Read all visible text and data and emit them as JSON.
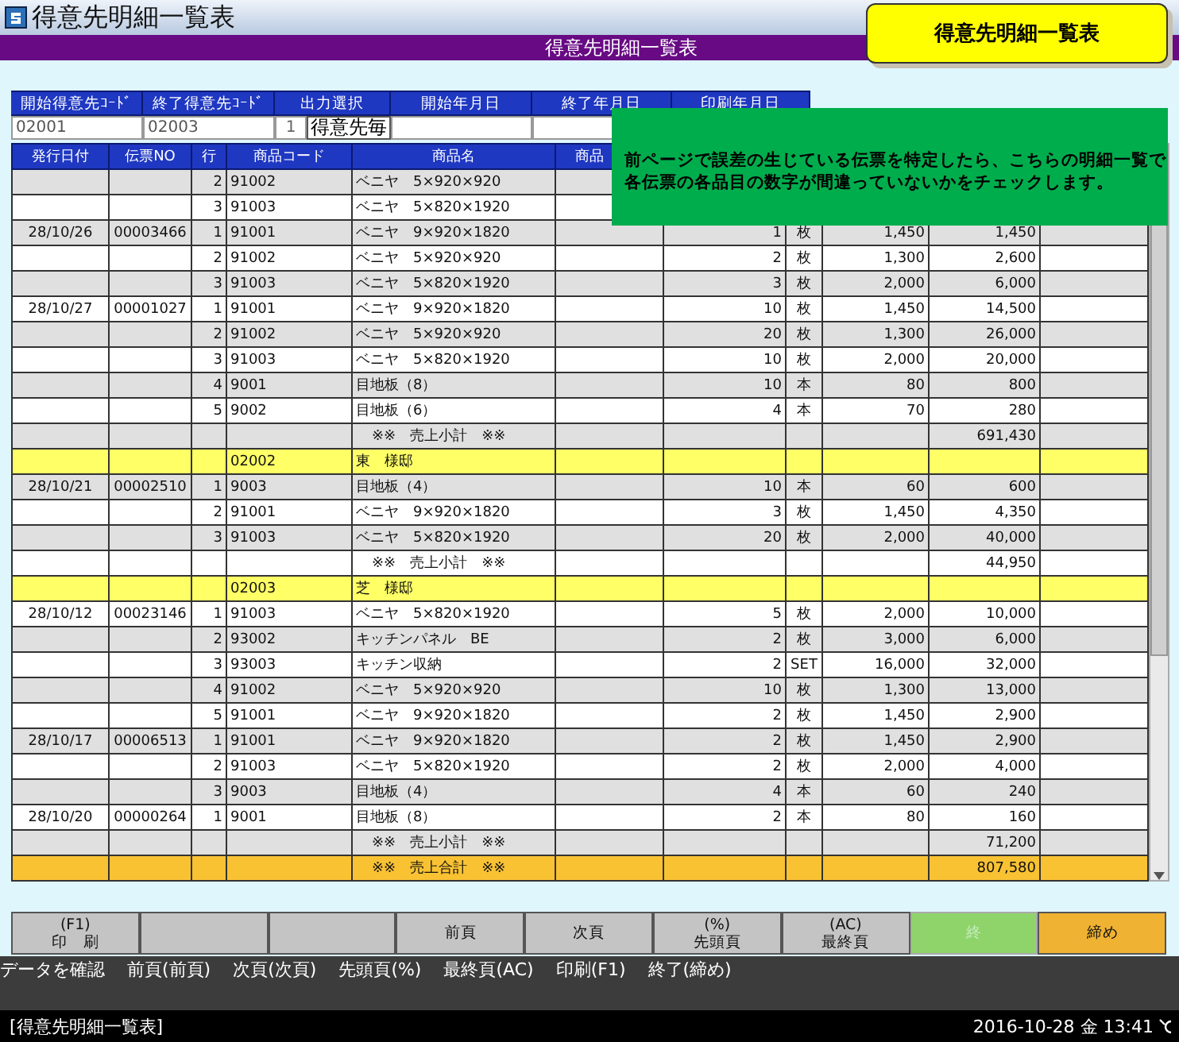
{
  "window": {
    "title": "得意先明細一覧表"
  },
  "header": {
    "title": "得意先明細一覧表"
  },
  "badge": {
    "text": "得意先明細一覧表"
  },
  "note": {
    "lines": [
      "前ページで誤差の生じている伝票を特定したら、こちらの明細一覧で",
      "各伝票の各品目の数字が間違っていないかをチェックします。"
    ]
  },
  "filters": {
    "labels": [
      "開始得意先ｺｰﾄﾞ",
      "終了得意先ｺｰﾄﾞ",
      "出力選択",
      "開始年月日",
      "終了年月日",
      "印刷年月日"
    ],
    "start_code": "02001",
    "end_code": "02003",
    "output_number": "1",
    "output_label": "得意先毎"
  },
  "table": {
    "columns": [
      "発行日付",
      "伝票NO",
      "行",
      "商品コード",
      "商品名",
      "商品"
    ],
    "rows": [
      {
        "kind": "item",
        "line": "2",
        "code": "91002",
        "name": "ベニヤ　5×920×920"
      },
      {
        "kind": "item",
        "line": "3",
        "code": "91003",
        "name": "ベニヤ　5×820×1920"
      },
      {
        "kind": "item",
        "date": "28/10/26",
        "slip_no": "00003466",
        "line": "1",
        "code": "91001",
        "name": "ベニヤ　9×920×1820",
        "qty": "1",
        "unit": "枚",
        "price": "1,450",
        "amount": "1,450"
      },
      {
        "kind": "item",
        "line": "2",
        "code": "91002",
        "name": "ベニヤ　5×920×920",
        "qty": "2",
        "unit": "枚",
        "price": "1,300",
        "amount": "2,600"
      },
      {
        "kind": "item",
        "line": "3",
        "code": "91003",
        "name": "ベニヤ　5×820×1920",
        "qty": "3",
        "unit": "枚",
        "price": "2,000",
        "amount": "6,000"
      },
      {
        "kind": "item",
        "date": "28/10/27",
        "slip_no": "00001027",
        "line": "1",
        "code": "91001",
        "name": "ベニヤ　9×920×1820",
        "qty": "10",
        "unit": "枚",
        "price": "1,450",
        "amount": "14,500"
      },
      {
        "kind": "item",
        "line": "2",
        "code": "91002",
        "name": "ベニヤ　5×920×920",
        "qty": "20",
        "unit": "枚",
        "price": "1,300",
        "amount": "26,000"
      },
      {
        "kind": "item",
        "line": "3",
        "code": "91003",
        "name": "ベニヤ　5×820×1920",
        "qty": "10",
        "unit": "枚",
        "price": "2,000",
        "amount": "20,000"
      },
      {
        "kind": "item",
        "line": "4",
        "code": "9001",
        "name": "目地板（8）",
        "qty": "10",
        "unit": "本",
        "price": "80",
        "amount": "800"
      },
      {
        "kind": "item",
        "line": "5",
        "code": "9002",
        "name": "目地板（6）",
        "qty": "4",
        "unit": "本",
        "price": "70",
        "amount": "280"
      },
      {
        "kind": "subtotal",
        "name": "※※　売上小計　※※",
        "amount": "691,430"
      },
      {
        "kind": "group",
        "code": "02002",
        "name": "東　様邸"
      },
      {
        "kind": "item",
        "date": "28/10/21",
        "slip_no": "00002510",
        "line": "1",
        "code": "9003",
        "name": "目地板（4）",
        "qty": "10",
        "unit": "本",
        "price": "60",
        "amount": "600"
      },
      {
        "kind": "item",
        "line": "2",
        "code": "91001",
        "name": "ベニヤ　9×920×1820",
        "qty": "3",
        "unit": "枚",
        "price": "1,450",
        "amount": "4,350"
      },
      {
        "kind": "item",
        "line": "3",
        "code": "91003",
        "name": "ベニヤ　5×820×1920",
        "qty": "20",
        "unit": "枚",
        "price": "2,000",
        "amount": "40,000"
      },
      {
        "kind": "subtotal",
        "name": "※※　売上小計　※※",
        "amount": "44,950"
      },
      {
        "kind": "group",
        "code": "02003",
        "name": "芝　様邸"
      },
      {
        "kind": "item",
        "date": "28/10/12",
        "slip_no": "00023146",
        "line": "1",
        "code": "91003",
        "name": "ベニヤ　5×820×1920",
        "qty": "5",
        "unit": "枚",
        "price": "2,000",
        "amount": "10,000"
      },
      {
        "kind": "item",
        "line": "2",
        "code": "93002",
        "name": "キッチンパネル　BE",
        "qty": "2",
        "unit": "枚",
        "price": "3,000",
        "amount": "6,000"
      },
      {
        "kind": "item",
        "line": "3",
        "code": "93003",
        "name": "キッチン収納",
        "qty": "2",
        "unit": "SET",
        "price": "16,000",
        "amount": "32,000"
      },
      {
        "kind": "item",
        "line": "4",
        "code": "91002",
        "name": "ベニヤ　5×920×920",
        "qty": "10",
        "unit": "枚",
        "price": "1,300",
        "amount": "13,000"
      },
      {
        "kind": "item",
        "line": "5",
        "code": "91001",
        "name": "ベニヤ　9×920×1820",
        "qty": "2",
        "unit": "枚",
        "price": "1,450",
        "amount": "2,900"
      },
      {
        "kind": "item",
        "date": "28/10/17",
        "slip_no": "00006513",
        "line": "1",
        "code": "91001",
        "name": "ベニヤ　9×920×1820",
        "qty": "2",
        "unit": "枚",
        "price": "1,450",
        "amount": "2,900"
      },
      {
        "kind": "item",
        "line": "2",
        "code": "91003",
        "name": "ベニヤ　5×820×1920",
        "qty": "2",
        "unit": "枚",
        "price": "2,000",
        "amount": "4,000"
      },
      {
        "kind": "item",
        "line": "3",
        "code": "9003",
        "name": "目地板（4）",
        "qty": "4",
        "unit": "本",
        "price": "60",
        "amount": "240"
      },
      {
        "kind": "item",
        "date": "28/10/20",
        "slip_no": "00000264",
        "line": "1",
        "code": "9001",
        "name": "目地板（8）",
        "qty": "2",
        "unit": "本",
        "price": "80",
        "amount": "160"
      },
      {
        "kind": "subtotal",
        "name": "※※　売上小計　※※",
        "amount": "71,200"
      },
      {
        "kind": "total",
        "name": "※※　売上合計　※※",
        "amount": "807,580"
      }
    ]
  },
  "function_keys": [
    {
      "shortcut": "(F1)",
      "label": "印　刷",
      "color": "#c4c4c4",
      "disabled": false
    },
    {
      "color": "#c4c4c4",
      "disabled": false
    },
    {
      "color": "#c4c4c4",
      "disabled": false
    },
    {
      "label": "前頁",
      "color": "#c4c4c4",
      "disabled": false
    },
    {
      "label": "次頁",
      "color": "#c4c4c4",
      "disabled": false
    },
    {
      "shortcut": "(%)",
      "label": "先頭頁",
      "color": "#c4c4c4",
      "disabled": false
    },
    {
      "shortcut": "(AC)",
      "label": "最終頁",
      "color": "#c4c4c4",
      "disabled": false
    },
    {
      "label": "終",
      "color": "#8fd46a",
      "disabled": true
    },
    {
      "label": "締め",
      "color": "#f0b232",
      "disabled": false
    }
  ],
  "hints": [
    "データを確認",
    "前頁(前頁)",
    "次頁(次頁)",
    "先頭頁(%)",
    "最終頁(AC)",
    "印刷(F1)",
    "終了(締め)"
  ],
  "status_bar": {
    "screen": "[得意先明細一覧表]",
    "datetime": "2016-10-28 金 13:41"
  }
}
